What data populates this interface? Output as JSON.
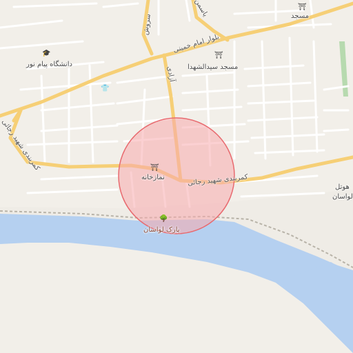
{
  "map": {
    "colors": {
      "land": "#f2efe9",
      "water": "#b5d0f0",
      "sand": "#efece6",
      "residential": "#e9e6e0",
      "major_road": "#f6cf76",
      "minor_road": "#ffffff",
      "rail": "#b8b3a8",
      "green": "#a8d4a0",
      "circle_fill": "#f7a9ad",
      "circle_stroke": "#e86a6f"
    },
    "roads": {
      "imam_khomeini": "بلوار امام خمینی",
      "azadi": "آزادی",
      "sorosh": "سروش",
      "yasmin": "یاسمن",
      "rajaei_east": "کمربندی شهید رجائی",
      "rajaei_west": "کمربندی شهید رجائی"
    },
    "places": {
      "mosque_top": "مسجد",
      "mosque_seyed": "مسجد سیدالشهدا",
      "university": "دانشگاه پیام نور",
      "namazkhaneh": "نمازخانه",
      "park": "پارک لواسان",
      "hotel": "هوتل\nلواسان",
      "hotel_line1": "هوتل",
      "hotel_line2": "لواسان"
    },
    "icons": {
      "mosque_top": "mosque-icon",
      "mosque_seyed": "mosque-icon",
      "university": "graduation-cap-icon",
      "clothes": "shirt-icon",
      "namazkhaneh": "prayer-room-icon",
      "park": "tree-icon"
    },
    "highlight_circle": {
      "present": true
    }
  }
}
